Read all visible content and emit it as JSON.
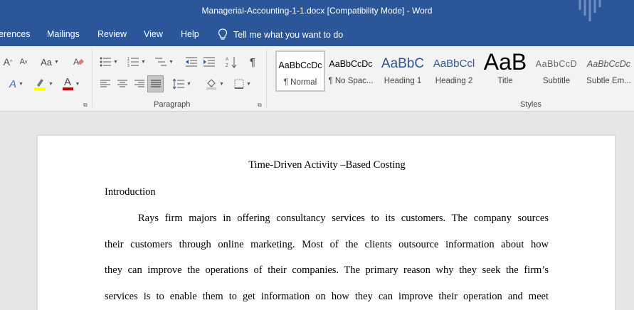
{
  "window": {
    "title": "Managerial-Accounting-1-1.docx [Compatibility Mode]  -  Word"
  },
  "ribbon_tabs": [
    "erences",
    "Mailings",
    "Review",
    "View",
    "Help"
  ],
  "tell_me": "Tell me what you want to do",
  "groups": {
    "paragraph": "Paragraph",
    "styles": "Styles"
  },
  "font_group": {
    "grow_font": "A",
    "shrink_font": "A",
    "change_case": "Aa",
    "text_effects": "A",
    "font_color": "A",
    "font_color_hex": "#c00000",
    "highlight_hex": "#ffff00"
  },
  "styles": [
    {
      "sample": "AaBbCcDc",
      "name": "¶ Normal"
    },
    {
      "sample": "AaBbCcDc",
      "name": "¶ No Spac..."
    },
    {
      "sample": "AaBbC",
      "name": "Heading 1"
    },
    {
      "sample": "AaBbCcl",
      "name": "Heading 2"
    },
    {
      "sample": "AaB",
      "name": "Title"
    },
    {
      "sample": "AaBbCcD",
      "name": "Subtitle"
    },
    {
      "sample": "AaBbCcDc",
      "name": "Subtle Em..."
    }
  ],
  "document": {
    "title": "Time-Driven Activity –Based Costing",
    "heading": "Introduction",
    "lines": [
      "Rays firm majors in offering consultancy services to its customers. The company sources",
      "their customers through online marketing. Most of the clients outsource information about how",
      "they can improve the operations of their companies. The primary reason why they seek the firm’s",
      "services is to enable them to get information on how they can improve their operation and meet"
    ]
  },
  "colors": {
    "titlebar": "#2b579a",
    "heading_style": "#2f5496"
  }
}
